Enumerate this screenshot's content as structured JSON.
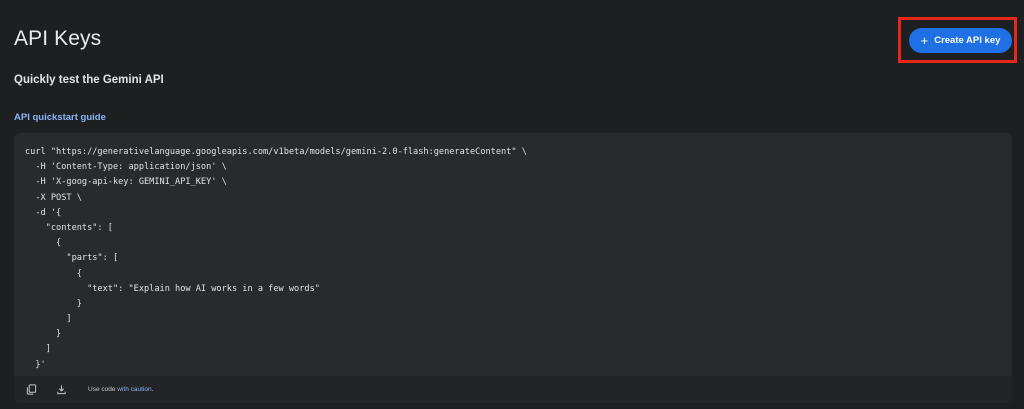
{
  "header": {
    "title": "API Keys",
    "create_button_label": "Create API key",
    "create_button_icon": "plus-icon",
    "accent_color": "#1f6fe5",
    "highlight_color": "#e8271b"
  },
  "section": {
    "subheading": "Quickly test the Gemini API",
    "guide_link": "API quickstart guide"
  },
  "code": {
    "lines": [
      "curl \"https://generativelanguage.googleapis.com/v1beta/models/gemini-2.0-flash:generateContent\" \\",
      "  -H 'Content-Type: application/json' \\",
      "  -H 'X-goog-api-key: GEMINI_API_KEY' \\",
      "  -X POST \\",
      "  -d '{",
      "    \"contents\": [",
      "      {",
      "        \"parts\": [",
      "          {",
      "            \"text\": \"Explain how AI works in a few words\"",
      "          }",
      "        ]",
      "      }",
      "    ]",
      "  }'"
    ],
    "footer": {
      "copy_icon": "copy-icon",
      "download_icon": "download-icon",
      "note_prefix": "Use code ",
      "note_link": "with caution",
      "note_suffix": "."
    }
  }
}
